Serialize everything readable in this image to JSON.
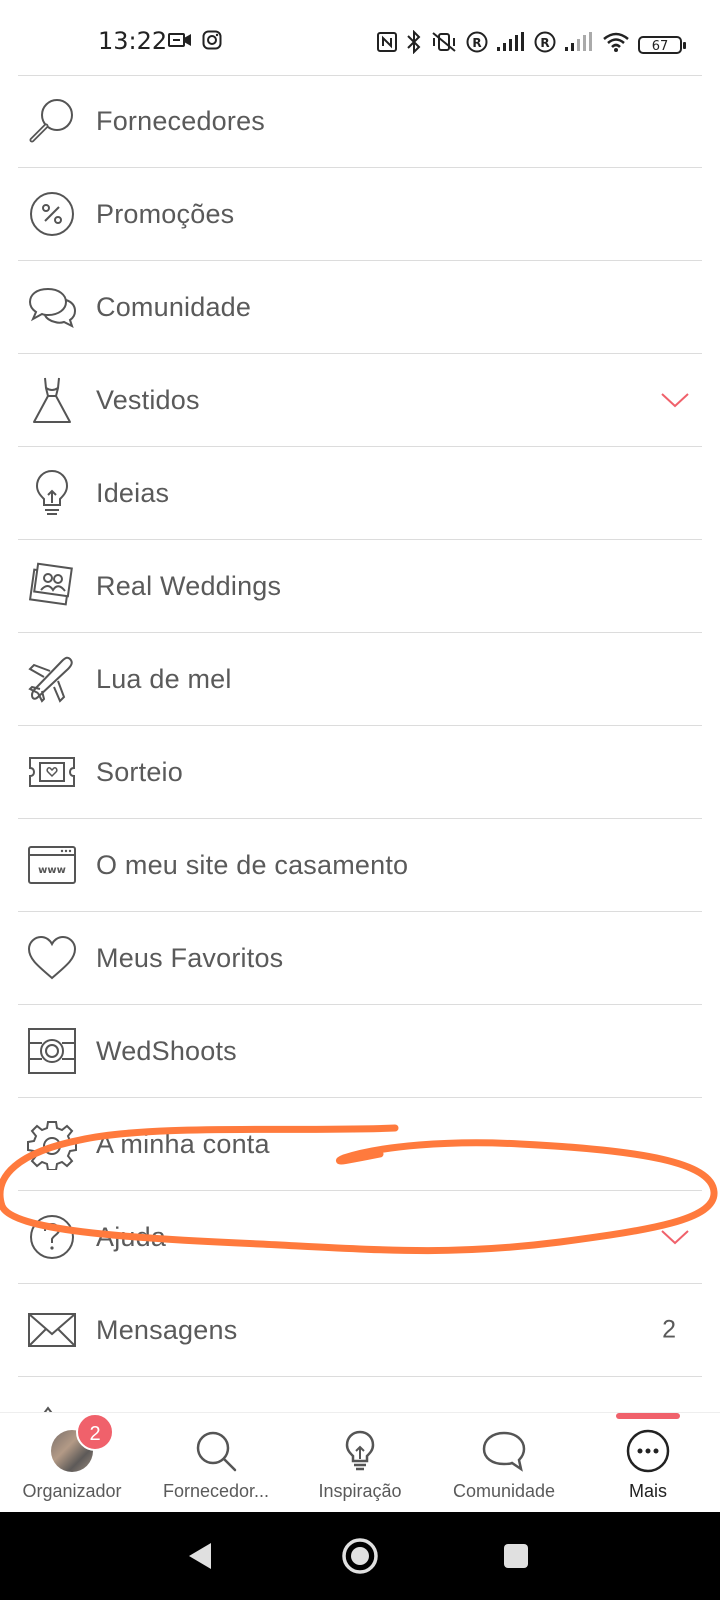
{
  "status_bar": {
    "time": "13:22",
    "battery": "67"
  },
  "menu": {
    "items": [
      {
        "label": "Fornecedores",
        "icon": "magnifier-icon"
      },
      {
        "label": "Promoções",
        "icon": "percent-icon"
      },
      {
        "label": "Comunidade",
        "icon": "chat-bubbles-icon"
      },
      {
        "label": "Vestidos",
        "icon": "dress-icon",
        "expandable": true
      },
      {
        "label": "Ideias",
        "icon": "lightbulb-icon"
      },
      {
        "label": "Real Weddings",
        "icon": "photos-icon"
      },
      {
        "label": "Lua de mel",
        "icon": "airplane-icon"
      },
      {
        "label": "Sorteio",
        "icon": "ticket-icon"
      },
      {
        "label": "O meu site de casamento",
        "icon": "website-icon"
      },
      {
        "label": "Meus Favoritos",
        "icon": "heart-icon"
      },
      {
        "label": "WedShoots",
        "icon": "camera-icon"
      },
      {
        "label": "A minha conta",
        "icon": "gear-icon"
      },
      {
        "label": "Ajuda",
        "icon": "help-icon",
        "expandable": true
      },
      {
        "label": "Mensagens",
        "icon": "envelope-icon",
        "count": "2"
      }
    ]
  },
  "bottom_nav": {
    "items": [
      {
        "label": "Organizador",
        "icon": "avatar",
        "badge": "2"
      },
      {
        "label": "Fornecedor...",
        "icon": "search-icon"
      },
      {
        "label": "Inspiração",
        "icon": "lightbulb-icon"
      },
      {
        "label": "Comunidade",
        "icon": "chat-icon"
      },
      {
        "label": "Mais",
        "icon": "more-icon",
        "active": true
      }
    ]
  },
  "colors": {
    "accent": "#f0616b",
    "annotation": "#ff7a3d",
    "text": "#5a5a5a",
    "divider": "#dcdcdc"
  }
}
